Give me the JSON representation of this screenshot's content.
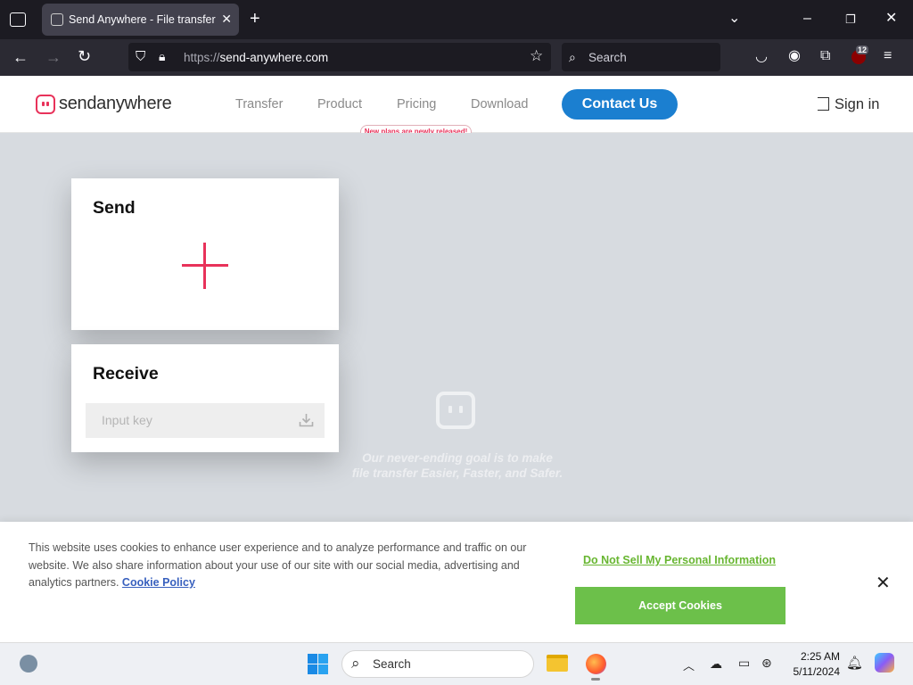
{
  "browser": {
    "tab_title": "Send Anywhere - File transfer",
    "url_prefix": "https://",
    "url_host": "send-anywhere.com",
    "search_placeholder": "Search",
    "extensions_badge": "12"
  },
  "site": {
    "logo_send": "send",
    "logo_anywhere": "anywhere",
    "nav": [
      "Transfer",
      "Product",
      "Pricing",
      "Download"
    ],
    "contact_label": "Contact Us",
    "pricing_badge": "New plans are newly released!",
    "signin_label": "Sign in"
  },
  "send_card": {
    "title": "Send"
  },
  "receive_card": {
    "title": "Receive",
    "input_placeholder": "Input key"
  },
  "tagline": {
    "line1": "Our never-ending goal is to make",
    "line2": "file transfer Easier, Faster, and Safer."
  },
  "cookie": {
    "text": "This website uses cookies to enhance user experience and to analyze performance and traffic on our website. We also share information about your use of our site with our social media, advertising and analytics partners.",
    "policy_link": "Cookie Policy",
    "do_not_sell": "Do Not Sell My Personal Information",
    "accept": "Accept Cookies"
  },
  "taskbar": {
    "search_label": "Search",
    "time": "2:25 AM",
    "date": "5/11/2024"
  },
  "colors": {
    "brand_pink": "#e8325a",
    "contact_blue": "#1b7fd0",
    "accept_green": "#6cc04a",
    "link_green": "#68b631"
  }
}
